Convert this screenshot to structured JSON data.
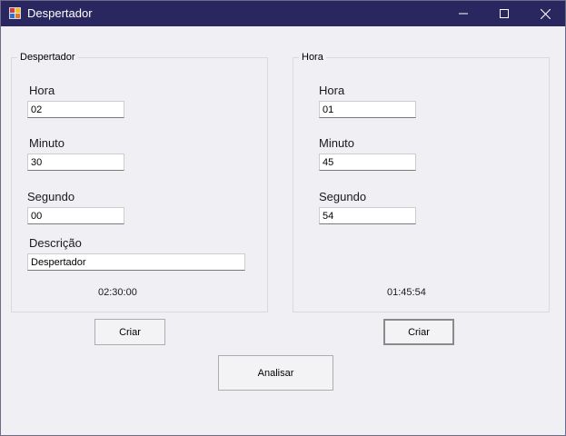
{
  "window": {
    "title": "Despertador",
    "icon": "app-form-icon"
  },
  "alarm_group": {
    "title": "Despertador",
    "hora_label": "Hora",
    "hora_value": "02",
    "minuto_label": "Minuto",
    "minuto_value": "30",
    "segundo_label": "Segundo",
    "segundo_value": "00",
    "descricao_label": "Descrição",
    "descricao_value": "Despertador",
    "result": "02:30:00",
    "button_label": "Criar"
  },
  "time_group": {
    "title": "Hora",
    "hora_label": "Hora",
    "hora_value": "01",
    "minuto_label": "Minuto",
    "minuto_value": "45",
    "segundo_label": "Segundo",
    "segundo_value": "54",
    "result": "01:45:54",
    "button_label": "Criar"
  },
  "analyze_button": "Analisar",
  "colors": {
    "titlebar": "#2a2760",
    "background": "#f0eff3"
  }
}
